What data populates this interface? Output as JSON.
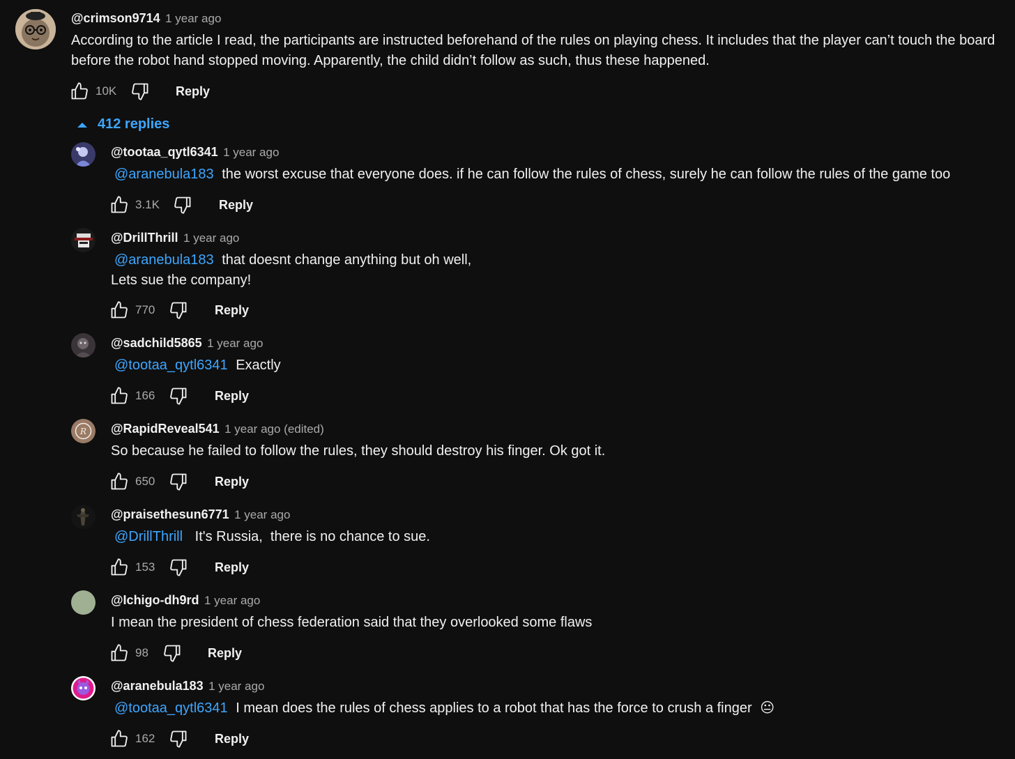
{
  "top_comment": {
    "author": "@crimson9714",
    "time": "1 year ago",
    "text_line1": "According to the article I read, the participants are instructed beforehand of the rules on playing chess. It includes that the player can’t touch the board",
    "text_line2": "before the robot hand stopped moving. Apparently, the child didn’t follow as such, thus these happened.",
    "likes": "10K",
    "reply_label": "Reply",
    "replies_toggle": "412 replies"
  },
  "replies": [
    {
      "author": "@tootaa_qytl6341",
      "time": "1 year ago",
      "mention": "@aranebula183",
      "text": "the worst excuse that everyone does. if he can follow the rules of chess, surely he can follow the rules of the game too",
      "likes": "3.1K",
      "reply_label": "Reply"
    },
    {
      "author": "@DrillThrill",
      "time": "1 year ago",
      "mention": "@aranebula183",
      "text": "that doesnt change anything but oh well,",
      "text_line2": "Lets sue the company!",
      "likes": "770",
      "reply_label": "Reply"
    },
    {
      "author": "@sadchild5865",
      "time": "1 year ago",
      "mention": "@tootaa_qytl6341",
      "text": "Exactly",
      "likes": "166",
      "reply_label": "Reply"
    },
    {
      "author": "@RapidReveal541",
      "time": "1 year ago (edited)",
      "text": "So because he failed to follow the rules, they should destroy his finger. Ok got it.",
      "likes": "650",
      "reply_label": "Reply"
    },
    {
      "author": "@praisethesun6771",
      "time": "1 year ago",
      "mention": "@DrillThrill",
      "text": "It's Russia,  there is no chance to sue.",
      "likes": "153",
      "reply_label": "Reply"
    },
    {
      "author": "@Ichigo-dh9rd",
      "time": "1 year ago",
      "text": "I mean the president of chess federation said that they overlooked some flaws",
      "likes": "98",
      "reply_label": "Reply"
    },
    {
      "author": "@aranebula183",
      "time": "1 year ago",
      "mention": "@tootaa_qytl6341",
      "text": "I mean does the rules of chess applies to a robot that has the force to crush a finger",
      "emoji": "😐",
      "likes": "162",
      "reply_label": "Reply"
    }
  ],
  "colors": {
    "background": "#0f0f0f",
    "text": "#f1f1f1",
    "secondary": "#aaaaaa",
    "link": "#3ea6ff"
  }
}
